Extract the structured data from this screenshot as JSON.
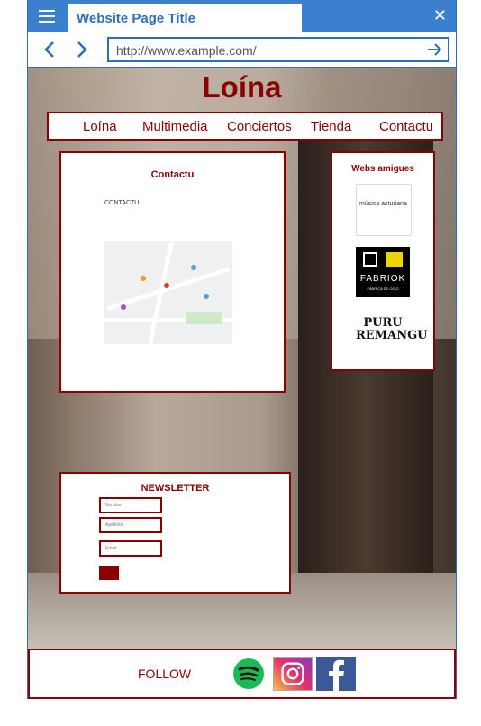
{
  "browser": {
    "tab_title": "Website Page Title",
    "url": "http://www.example.com/",
    "icons": [
      "menu-icon",
      "close-icon",
      "back-icon",
      "forward-icon",
      "go-icon"
    ]
  },
  "site": {
    "title": "Loína",
    "nav": [
      "Loína",
      "Multimedia",
      "Conciertos",
      "Tienda",
      "Contactu"
    ]
  },
  "contact": {
    "heading": "Contactu",
    "label": "CONTACTU"
  },
  "friends": {
    "heading": "Webs amigues",
    "logos": [
      {
        "name": "música asturiana"
      },
      {
        "name": "FABRIOK",
        "tagline": "FÁBRICA DE OCIO"
      },
      {
        "name": "PURU REMANGU"
      }
    ]
  },
  "newsletter": {
    "heading": "NEWSLETTER",
    "fields": [
      "Nombre",
      "Apellidos",
      "Email"
    ]
  },
  "footer": {
    "follow": "FOLLOW",
    "social": [
      "spotify-icon",
      "instagram-icon",
      "facebook-icon"
    ]
  },
  "colors": {
    "brand": "#8b0000",
    "browser_chrome": "#3b7fcf"
  }
}
